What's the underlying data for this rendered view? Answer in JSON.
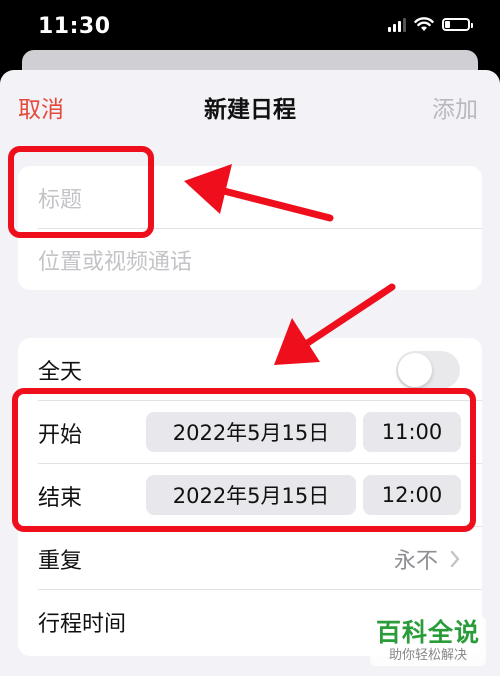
{
  "status_bar": {
    "time": "11:30",
    "icons": [
      "cellular-signal-icon",
      "wifi-icon",
      "battery-icon"
    ]
  },
  "nav": {
    "cancel": "取消",
    "title": "新建日程",
    "add": "添加"
  },
  "event": {
    "title_placeholder": "标题",
    "location_placeholder": "位置或视频通话"
  },
  "schedule": {
    "all_day_label": "全天",
    "all_day_on": false,
    "start_label": "开始",
    "start_date": "2022年5月15日",
    "start_time": "11:00",
    "end_label": "结束",
    "end_date": "2022年5月15日",
    "end_time": "12:00",
    "repeat_label": "重复",
    "repeat_value": "永不",
    "travel_label": "行程时间"
  },
  "watermark": {
    "name": "百科全说",
    "slogan": "助你轻松解决"
  },
  "colors": {
    "accent": "#e5493a",
    "annotation": "#ee0e1c",
    "watermark": "#2a9c3a"
  }
}
